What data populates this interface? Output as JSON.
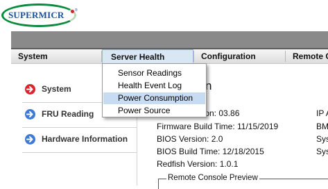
{
  "brand": {
    "logo_text": "SUPERMICR"
  },
  "menu": {
    "items": [
      {
        "label": "System"
      },
      {
        "label": "Server Health"
      },
      {
        "label": "Configuration"
      },
      {
        "label": "Remote C"
      }
    ]
  },
  "dropdown": {
    "items": [
      {
        "label": "Sensor Readings"
      },
      {
        "label": "Health Event Log"
      },
      {
        "label": "Power Consumption",
        "selected": true
      },
      {
        "label": "Power Source"
      }
    ]
  },
  "sidebar": {
    "items": [
      {
        "label": "System",
        "icon": "arrow-right-icon",
        "color": "#d9262e"
      },
      {
        "label": "FRU Reading",
        "icon": "arrow-right-icon",
        "color": "#3d7bd6"
      },
      {
        "label": "Hardware Information",
        "icon": "arrow-right-icon",
        "color": "#3d7bd6"
      }
    ]
  },
  "main": {
    "title": "n",
    "info": {
      "firmware_revision": "ision:  03.86",
      "firmware_build_time": "Firmware Build Time:  11/15/2019",
      "bios_version": "BIOS Version:  2.0",
      "bios_build_time": "BIOS Build Time:  12/18/2015",
      "redfish_version": "Redfish Version:  1.0.1"
    },
    "right_column": [
      "IP A",
      "BM",
      "Sys",
      "Sys"
    ],
    "remote_console_legend": "Remote Console Preview"
  },
  "colors": {
    "banner": "#8a8a8a",
    "menu_active": "#d9e6f4",
    "dropdown_selected": "#c7dbf2",
    "logo_green": "#0a8a3c",
    "logo_blue": "#1a4f9c",
    "logo_red": "#d6242a"
  }
}
